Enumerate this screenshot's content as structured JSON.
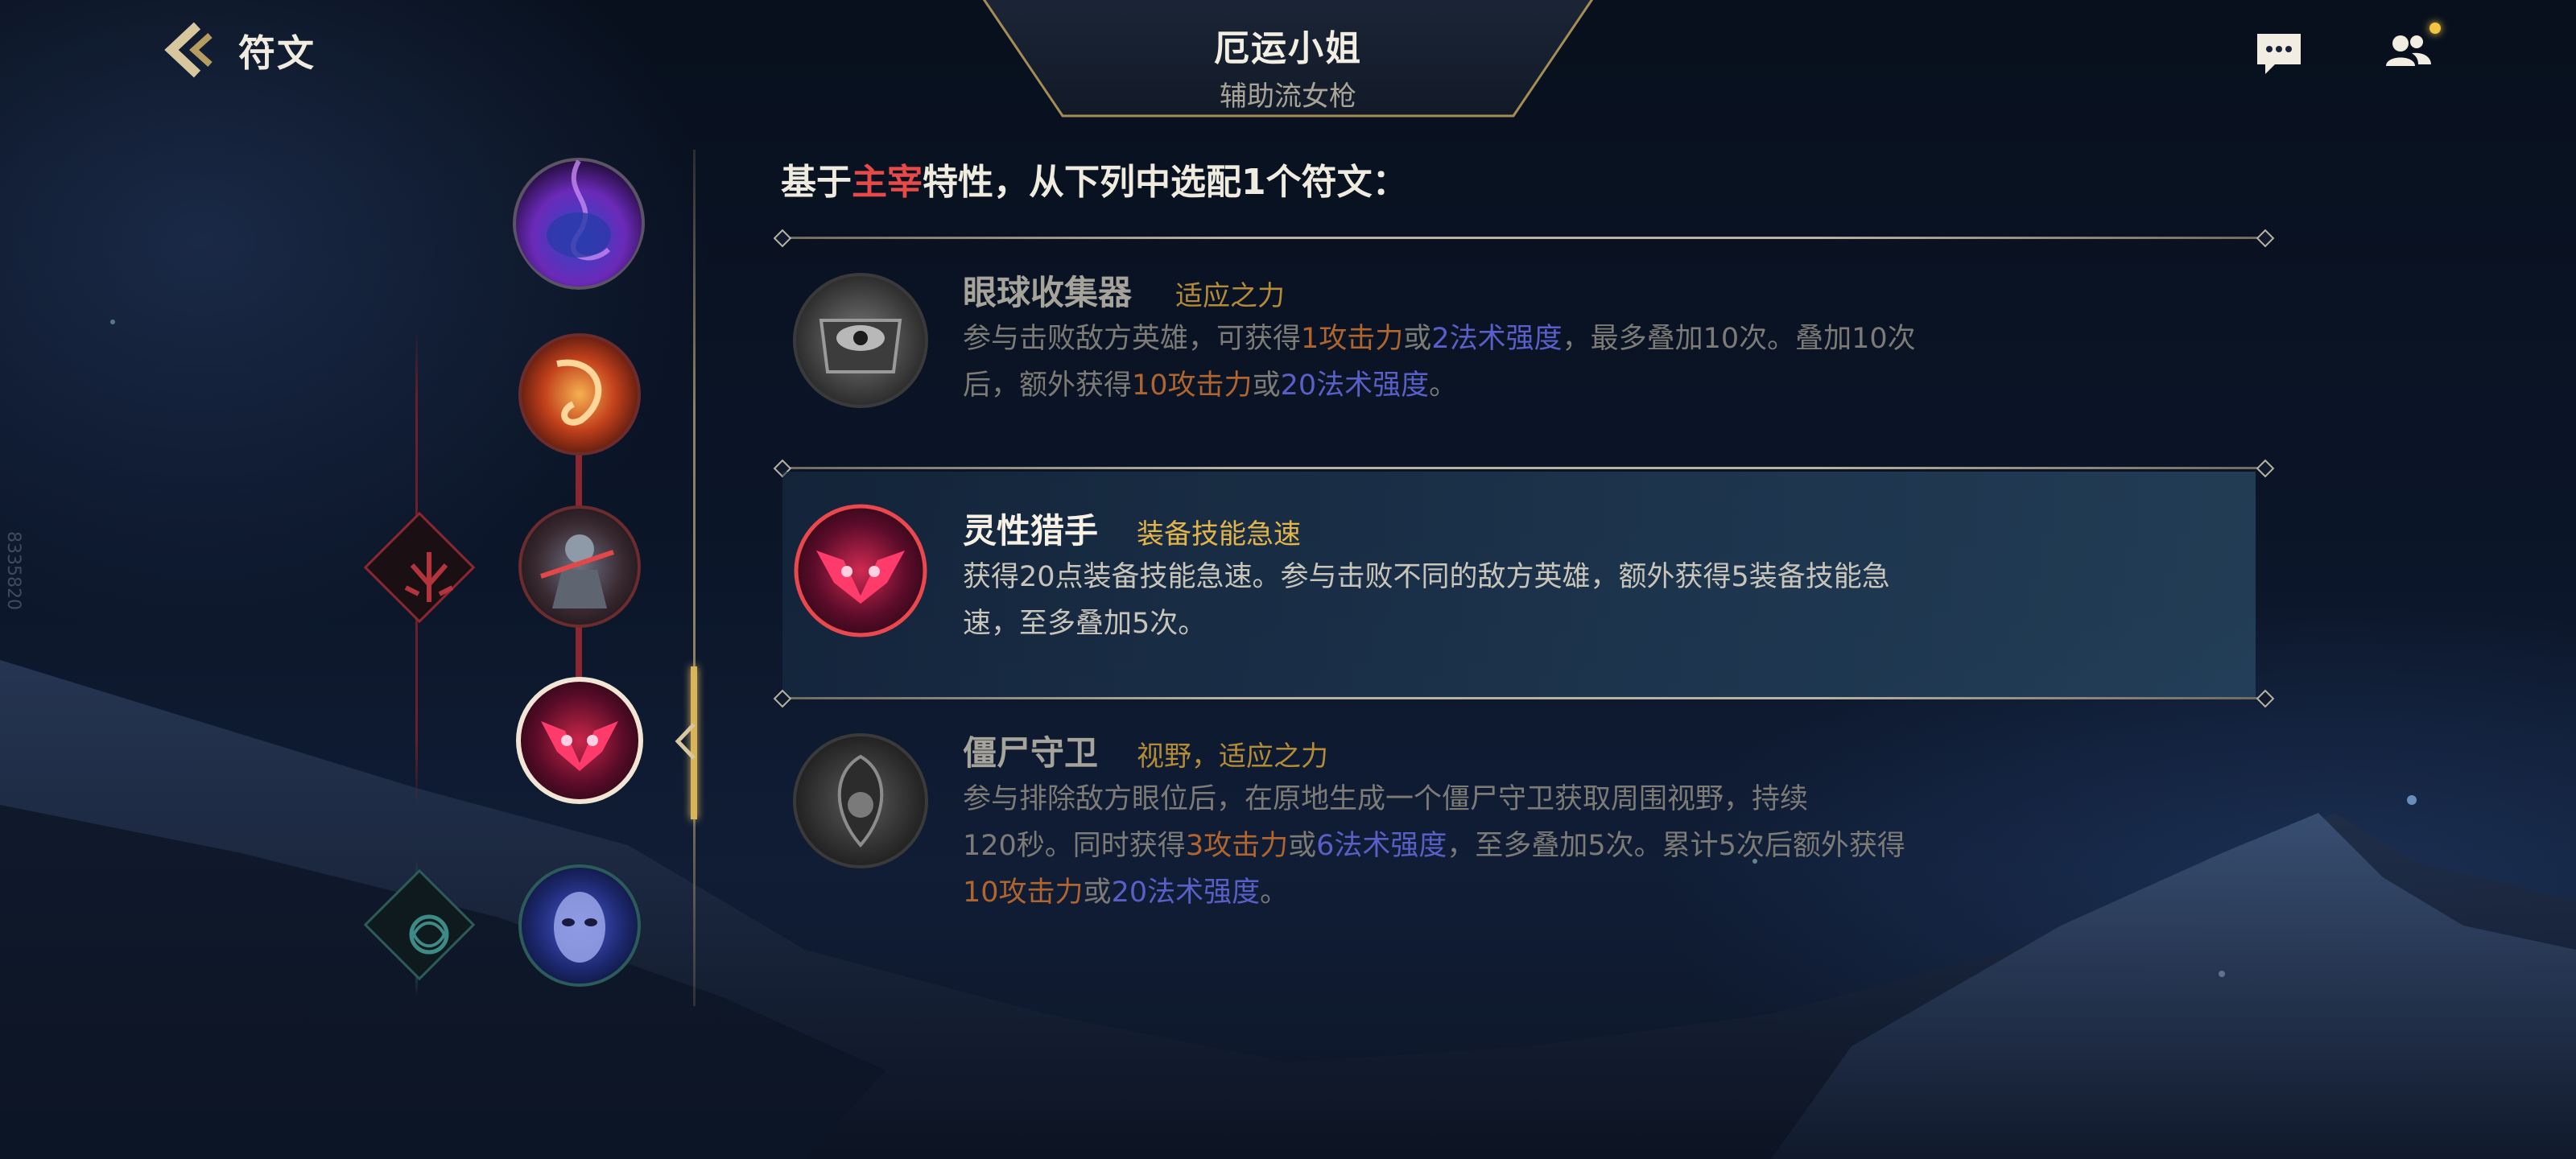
{
  "header": {
    "back_label": "符文",
    "hero_name": "厄运小姐",
    "hero_build": "辅助流女枪"
  },
  "watermark": "8335820",
  "prompt": {
    "prefix": "基于",
    "highlight": "主宰",
    "suffix": "特性，从下列中选配1个符文："
  },
  "options": [
    {
      "name": "眼球收集器",
      "tag": "适应之力",
      "selected": false,
      "desc_line1": [
        {
          "t": "参与击败敌方英雄，可获得",
          "c": ""
        },
        {
          "t": "1攻击力",
          "c": "ad"
        },
        {
          "t": "或",
          "c": ""
        },
        {
          "t": "2法术强度",
          "c": "ap"
        },
        {
          "t": "，最多叠加10次。叠加10次",
          "c": ""
        }
      ],
      "desc_line2": [
        {
          "t": "后，额外获得",
          "c": ""
        },
        {
          "t": "10攻击力",
          "c": "ad"
        },
        {
          "t": "或",
          "c": ""
        },
        {
          "t": "20法术强度",
          "c": "ap"
        },
        {
          "t": "。",
          "c": ""
        }
      ],
      "desc_line3": []
    },
    {
      "name": "灵性猎手",
      "tag": "装备技能急速",
      "selected": true,
      "desc_line1": [
        {
          "t": "获得20点装备技能急速。参与击败不同的敌方英雄，额外获得5装备技能急",
          "c": ""
        }
      ],
      "desc_line2": [
        {
          "t": "速，至多叠加5次。",
          "c": ""
        }
      ],
      "desc_line3": []
    },
    {
      "name": "僵尸守卫",
      "tag": "视野，适应之力",
      "selected": false,
      "desc_line1": [
        {
          "t": "参与排除敌方眼位后，在原地生成一个僵尸守卫获取周围视野，持续",
          "c": ""
        }
      ],
      "desc_line2": [
        {
          "t": "120秒。同时获得",
          "c": ""
        },
        {
          "t": "3攻击力",
          "c": "ad"
        },
        {
          "t": "或",
          "c": ""
        },
        {
          "t": "6法术强度",
          "c": "ap"
        },
        {
          "t": "，至多叠加5次。累计5次后额外获得",
          "c": ""
        }
      ],
      "desc_line3": [
        {
          "t": "10攻击力",
          "c": "ad"
        },
        {
          "t": "或",
          "c": ""
        },
        {
          "t": "20法术强度",
          "c": "ap"
        },
        {
          "t": "。",
          "c": ""
        }
      ]
    }
  ],
  "rune_slots": [
    {
      "icon": "dark-harvest-purple-icon",
      "state": "keystone"
    },
    {
      "icon": "fire-swirl-icon",
      "state": "chosen"
    },
    {
      "icon": "warrior-portrait-icon",
      "state": "chosen"
    },
    {
      "icon": "red-owl-icon",
      "state": "current"
    },
    {
      "icon": "blue-alien-face-icon",
      "state": "secondary"
    }
  ],
  "paths": [
    {
      "icon": "domination-path-icon",
      "color": "#8c2630"
    },
    {
      "icon": "inspiration-path-icon",
      "color": "#2c5c5a"
    }
  ],
  "colors": {
    "accent_gold": "#d8b45a",
    "highlight_red": "#e84a4a",
    "attack_damage": "#b0652e",
    "ability_power": "#5a5fc7"
  }
}
